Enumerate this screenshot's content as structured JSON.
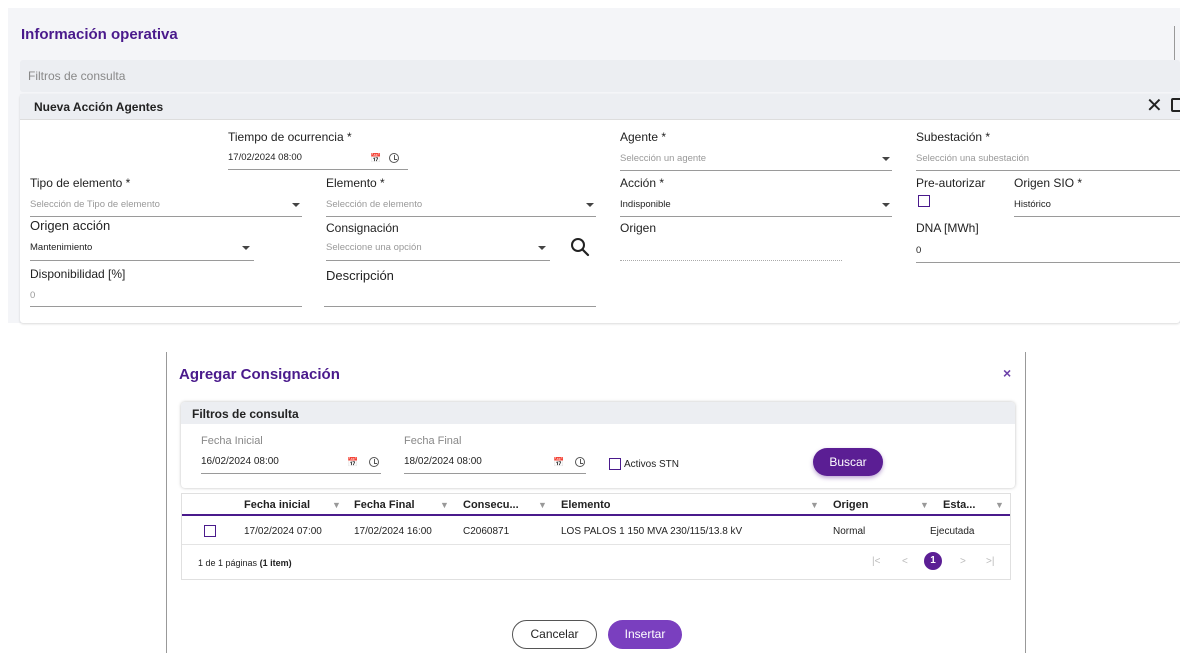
{
  "page": {
    "title": "Información operativa",
    "filters_label": "Filtros de consulta"
  },
  "card": {
    "title": "Nueva Acción Agentes",
    "fields": {
      "tiempo": {
        "label": "Tiempo de ocurrencia *",
        "value": "17/02/2024 08:00"
      },
      "agente": {
        "label": "Agente *",
        "placeholder": "Selección un agente"
      },
      "subestacion": {
        "label": "Subestación *",
        "placeholder": "Selección una subestación"
      },
      "tipo_elemento": {
        "label": "Tipo de elemento *",
        "placeholder": "Selección de Tipo de elemento"
      },
      "elemento": {
        "label": "Elemento *",
        "placeholder": "Selección de elemento"
      },
      "accion": {
        "label": "Acción *",
        "value": "Indisponible"
      },
      "preautorizar": {
        "label": "Pre-autorizar"
      },
      "origen_sio": {
        "label": "Origen SIO *",
        "value": "Histórico"
      },
      "origen_accion": {
        "label": "Origen acción",
        "value": "Mantenimiento"
      },
      "consignacion": {
        "label": "Consignación",
        "placeholder": "Seleccione una opción"
      },
      "origen": {
        "label": "Origen"
      },
      "dna": {
        "label": "DNA [MWh]",
        "value": "0"
      },
      "disponibilidad": {
        "label": "Disponibilidad [%]",
        "value": "0"
      },
      "descripcion": {
        "label": "Descripción"
      }
    }
  },
  "modal": {
    "title": "Agregar Consignación",
    "close": "×",
    "filters": {
      "title": "Filtros de consulta",
      "fecha_inicial_label": "Fecha Inicial",
      "fecha_inicial_value": "16/02/2024 08:00",
      "fecha_final_label": "Fecha Final",
      "fecha_final_value": "18/02/2024 08:00",
      "activos_label": "Activos STN",
      "buscar_label": "Buscar"
    },
    "grid": {
      "columns": [
        "Fecha inicial",
        "Fecha Final",
        "Consecu...",
        "Elemento",
        "Origen",
        "Esta..."
      ],
      "rows": [
        [
          "17/02/2024 07:00",
          "17/02/2024 16:00",
          "C2060871",
          "LOS PALOS 1 150 MVA 230/115/13.8 kV",
          "Normal",
          "Ejecutada"
        ]
      ],
      "pager_text": "1 de 1 páginas",
      "pager_items": "(1 item)",
      "current_page": "1"
    },
    "buttons": {
      "cancel": "Cancelar",
      "insert": "Insertar"
    }
  },
  "colors": {
    "accent": "#4a1a8c",
    "button": "#5b1e94",
    "insert": "#7a3fbf"
  }
}
